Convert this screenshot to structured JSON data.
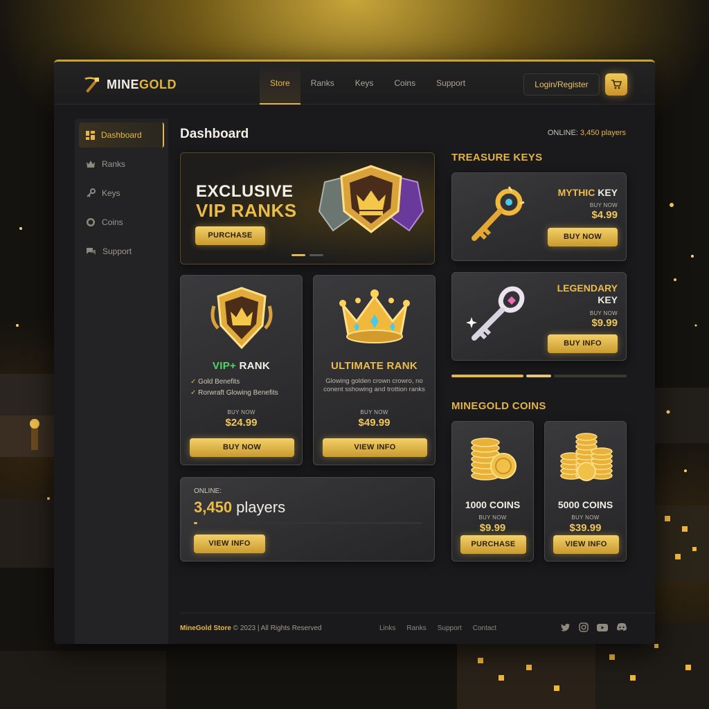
{
  "brand": {
    "name_part1": "MINE",
    "name_part2": "GOLD"
  },
  "nav": {
    "items": [
      "Store",
      "Ranks",
      "Keys",
      "Coins",
      "Support"
    ],
    "active": "Store"
  },
  "header": {
    "login_label": "Login/Register"
  },
  "sidebar": {
    "items": [
      {
        "label": "Dashboard",
        "icon": "dashboard-icon"
      },
      {
        "label": "Ranks",
        "icon": "crown-icon"
      },
      {
        "label": "Keys",
        "icon": "key-icon"
      },
      {
        "label": "Coins",
        "icon": "coin-icon"
      },
      {
        "label": "Support",
        "icon": "chat-icon"
      }
    ]
  },
  "main": {
    "title": "Dashboard",
    "online_label": "ONLINE: ",
    "online_value": "3,450 players"
  },
  "hero": {
    "line1": "EXCLUSIVE",
    "line2": "VIP RANKS",
    "button": "PURCHASE"
  },
  "ranks": [
    {
      "title_part1": "VIP+",
      "title_part2": " RANK",
      "features": [
        "Gold Benefits",
        "Rorwraft Glowing Benefits"
      ],
      "buy_label": "BUY NOW",
      "price": "$24.99",
      "button": "BUY NOW"
    },
    {
      "title": "ULTIMATE RANK",
      "description": "Glowing golden crown crowro, no conent sshowing and trottion ranks",
      "buy_label": "BUY NOW",
      "price": "$49.99",
      "button": "VIEW INFO"
    }
  ],
  "online_card": {
    "label": "ONLINE:",
    "value": "3,450",
    "unit": " players",
    "button": "VIEW INFO"
  },
  "keys_section": {
    "title": "TREASURE KEYS"
  },
  "keys": [
    {
      "name_part1": "MYTHIC",
      "name_part2": " KEY",
      "buy_label": "BUY NOW",
      "price": "$4.99",
      "button": "BUY NOW"
    },
    {
      "name_part1": "LEGENDARY",
      "name_part2": "KEY",
      "buy_label": "BUY NOW",
      "price": "$9.99",
      "button": "BUY INFO"
    }
  ],
  "coins_section": {
    "title": "MINEGOLD COINS"
  },
  "coins": [
    {
      "title": "1000 COINS",
      "buy_label": "BUY NOW",
      "price": "$9.99",
      "button": "PURCHASE"
    },
    {
      "title": "5000 COINS",
      "buy_label": "BUY NOW",
      "price": "$39.99",
      "button": "VIEW INFO"
    }
  ],
  "footer": {
    "brand": "MineGold Store",
    "copyright": " © 2023 | All Rights Reserved",
    "links": [
      "Links",
      "Ranks",
      "Support",
      "Contact"
    ],
    "social_icons": [
      "twitter-icon",
      "instagram-icon",
      "youtube-icon",
      "discord-icon"
    ]
  },
  "colors": {
    "accent": "#e6b64a",
    "background": "#1a1a1c",
    "green": "#4fd86a"
  }
}
